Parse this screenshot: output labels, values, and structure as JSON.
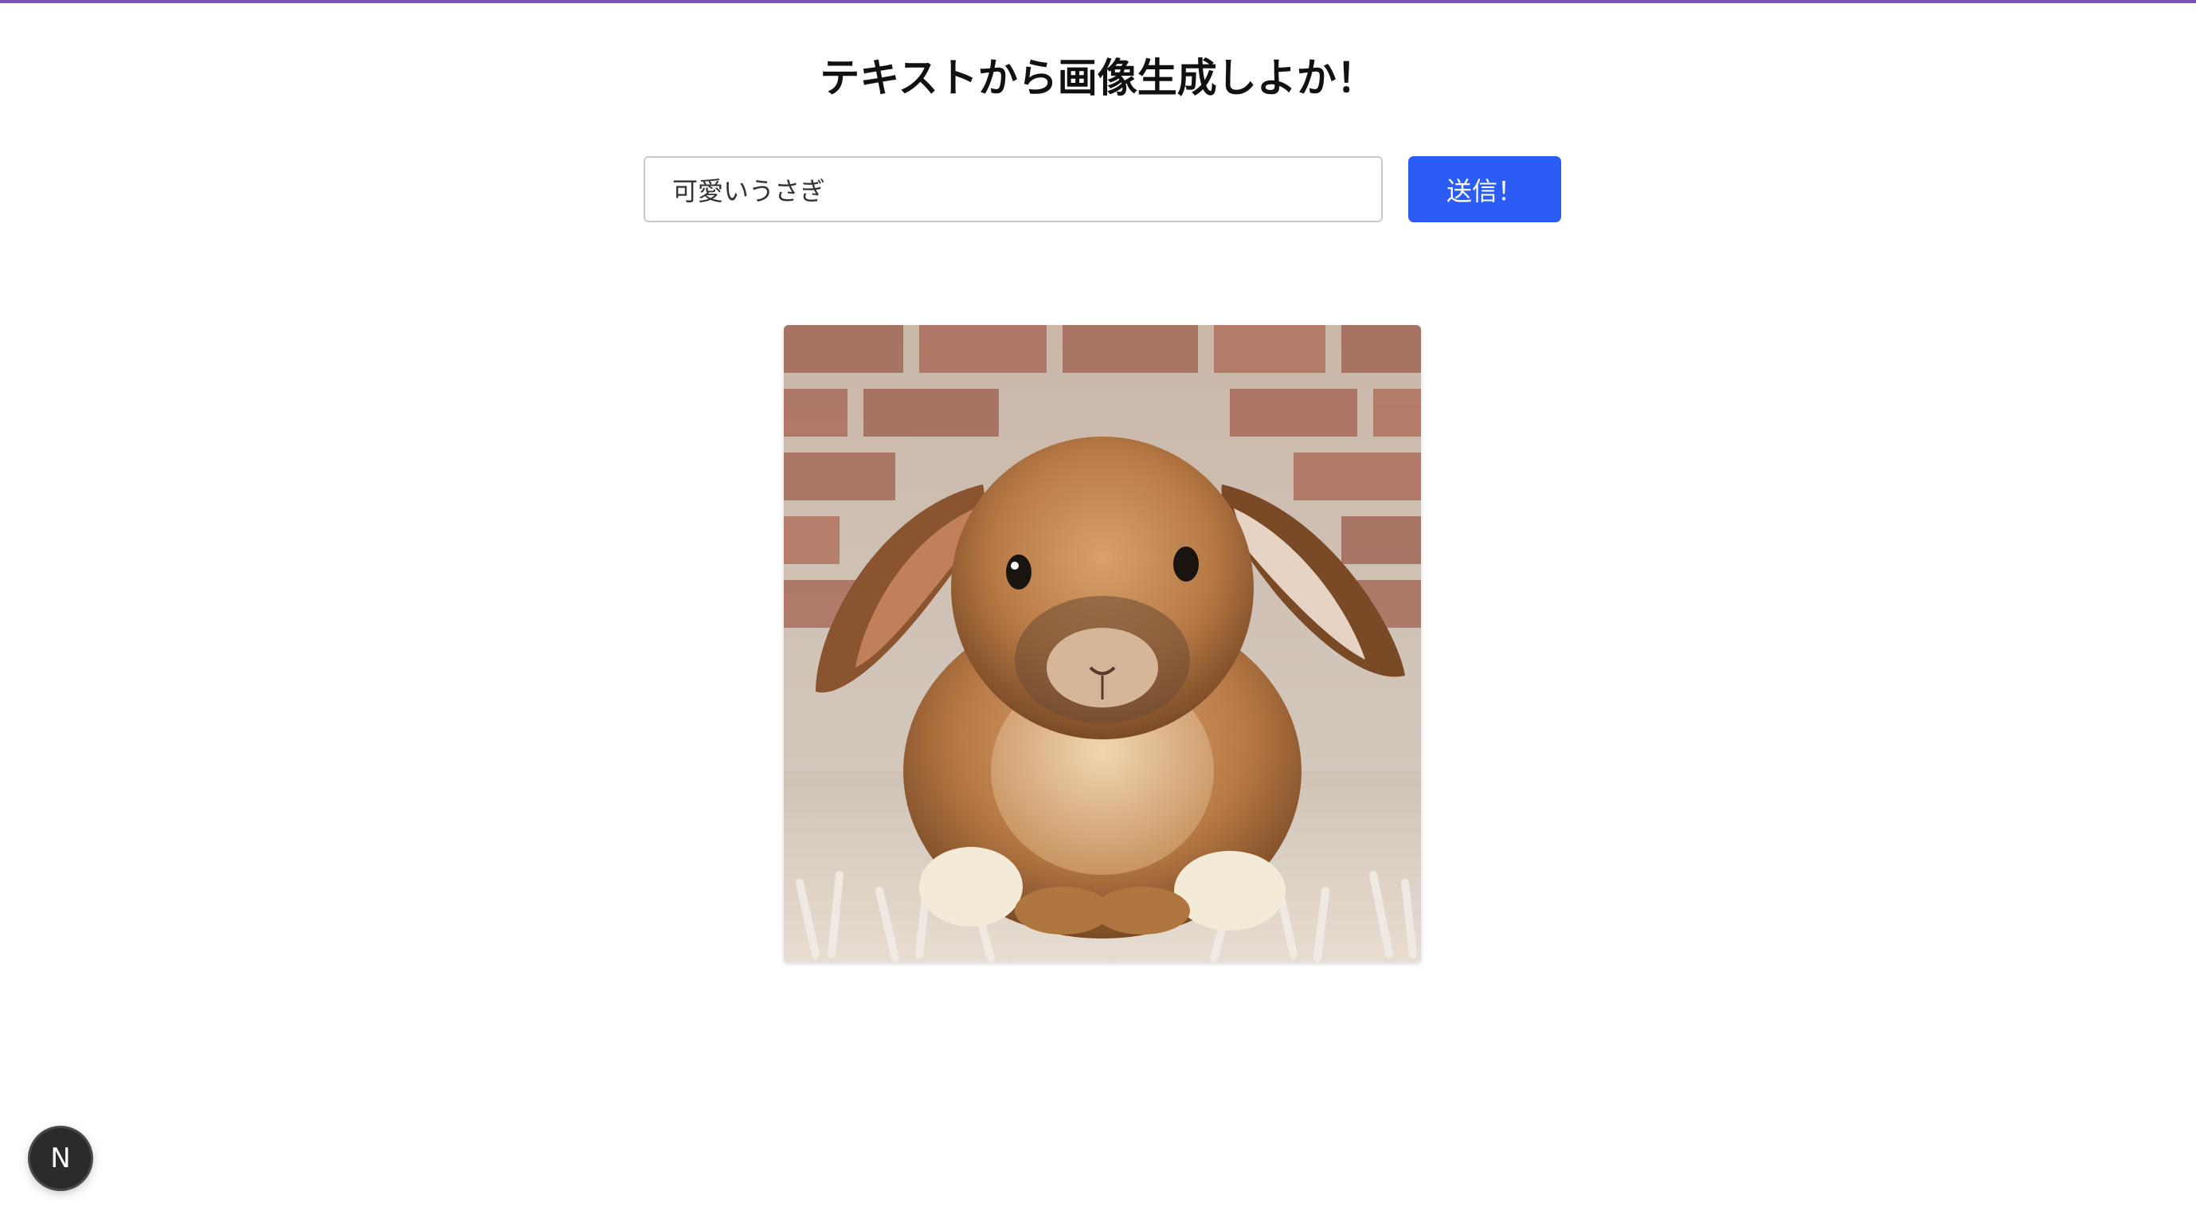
{
  "header": {
    "title": "テキストから画像生成しよか！",
    "accent_color": "#7b52b8"
  },
  "form": {
    "prompt_value": "可愛いうさぎ",
    "submit_label": "送信！",
    "button_color": "#2b5cf6"
  },
  "result": {
    "image_subject": "rabbit-photo"
  },
  "dev_badge": {
    "label": "N",
    "icon": "nextjs-icon"
  }
}
